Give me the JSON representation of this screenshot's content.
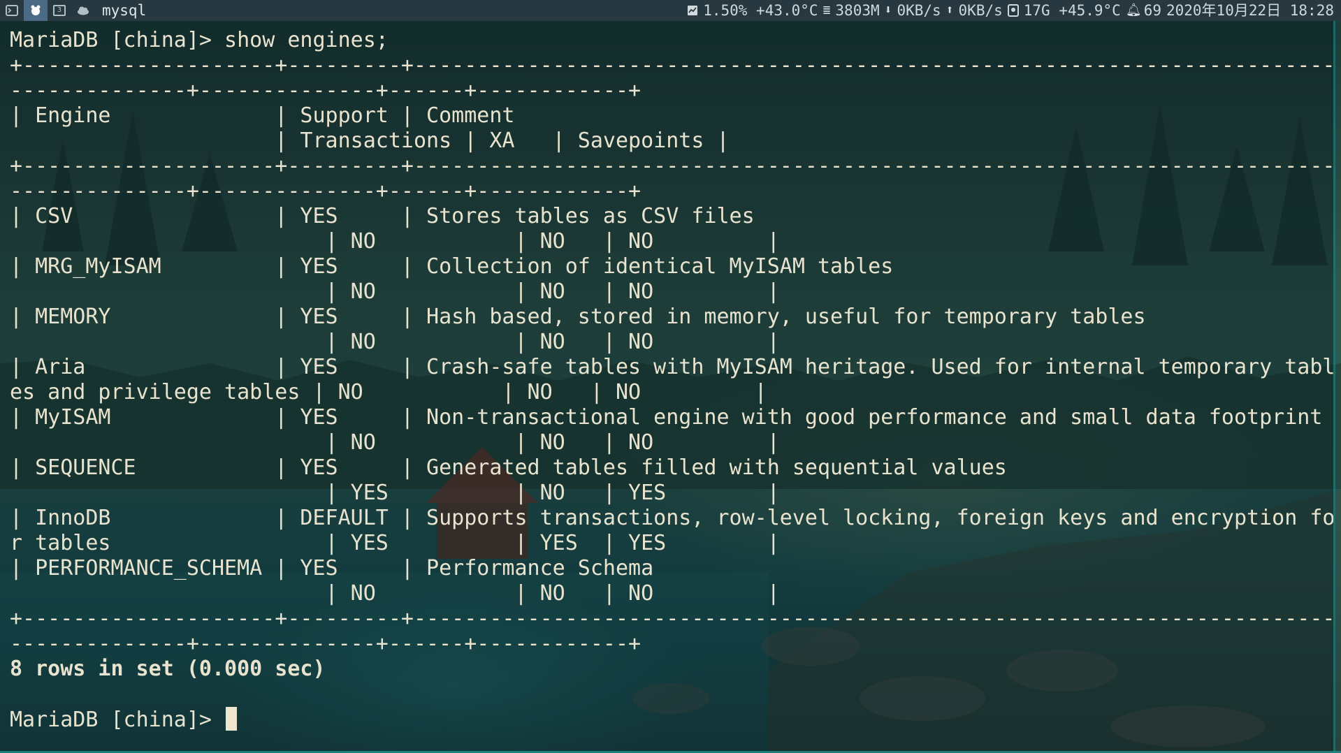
{
  "topbar": {
    "window_title": "mysql",
    "cpu": "1.50% +43.0°C",
    "memory": "3803M",
    "net_down": "0KB/s",
    "net_up": "0KB/s",
    "disk": "17G +45.9°C",
    "notifications": "69",
    "datetime": "2020年10月22日 18:28",
    "icons": [
      "terminal-icon",
      "app-icon",
      "workspace-icon",
      "cloud-icon",
      "cpu-chart-icon",
      "memory-db-icon",
      "download-arrow-icon",
      "upload-arrow-icon",
      "disk-icon",
      "bell-icon"
    ]
  },
  "terminal": {
    "lines": [
      {
        "text": "MariaDB [china]> show engines;",
        "bold": false
      },
      {
        "text": "+--------------------+---------+----------------------------------------------------------------------------+",
        "bold": false
      },
      {
        "text": "--------------+--------------+------+------------+",
        "bold": false
      },
      {
        "text": "| Engine             | Support | Comment",
        "bold": false
      },
      {
        "text": "                     | Transactions | XA   | Savepoints |",
        "bold": false
      },
      {
        "text": "+--------------------+---------+----------------------------------------------------------------------------+",
        "bold": false
      },
      {
        "text": "--------------+--------------+------+------------+",
        "bold": false
      },
      {
        "text": "| CSV                | YES     | Stores tables as CSV files",
        "bold": false
      },
      {
        "text": "                         | NO           | NO   | NO         |",
        "bold": false
      },
      {
        "text": "| MRG_MyISAM         | YES     | Collection of identical MyISAM tables",
        "bold": false
      },
      {
        "text": "                         | NO           | NO   | NO         |",
        "bold": false
      },
      {
        "text": "| MEMORY             | YES     | Hash based, stored in memory, useful for temporary tables",
        "bold": false
      },
      {
        "text": "                         | NO           | NO   | NO         |",
        "bold": false
      },
      {
        "text": "| Aria               | YES     | Crash-safe tables with MyISAM heritage. Used for internal temporary tabl",
        "bold": false
      },
      {
        "text": "es and privilege tables | NO           | NO   | NO         |",
        "bold": false
      },
      {
        "text": "| MyISAM             | YES     | Non-transactional engine with good performance and small data footprint",
        "bold": false
      },
      {
        "text": "                         | NO           | NO   | NO         |",
        "bold": false
      },
      {
        "text": "| SEQUENCE           | YES     | Generated tables filled with sequential values",
        "bold": false
      },
      {
        "text": "                         | YES          | NO   | YES        |",
        "bold": false
      },
      {
        "text": "| InnoDB             | DEFAULT | Supports transactions, row-level locking, foreign keys and encryption fo",
        "bold": false
      },
      {
        "text": "r tables                 | YES          | YES  | YES        |",
        "bold": false
      },
      {
        "text": "| PERFORMANCE_SCHEMA | YES     | Performance Schema",
        "bold": false
      },
      {
        "text": "                         | NO           | NO   | NO         |",
        "bold": false
      },
      {
        "text": "+--------------------+---------+----------------------------------------------------------------------------+",
        "bold": false
      },
      {
        "text": "--------------+--------------+------+------------+",
        "bold": false
      },
      {
        "text": "8 rows in set (0.000 sec)",
        "bold": true
      },
      {
        "text": "",
        "bold": false
      }
    ],
    "prompt": "MariaDB [china]> "
  }
}
